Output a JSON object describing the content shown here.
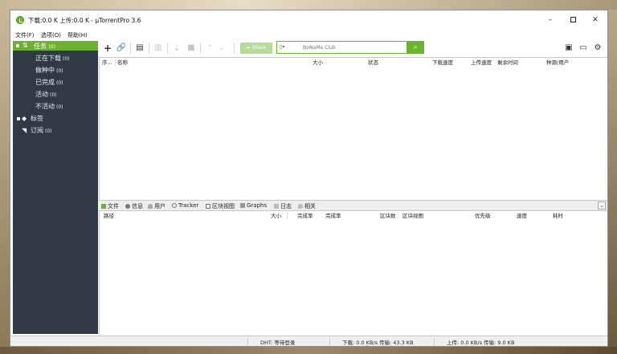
{
  "window": {
    "title": "下载:0.0 K 上传:0.0 K - µTorrentPro 3.6",
    "controls": {
      "minimize": "–",
      "close": "✕"
    }
  },
  "menu": [
    "文件(F)",
    "选项(O)",
    "帮助(H)"
  ],
  "sidebar": {
    "tasks": {
      "label": "任务",
      "count": "(0)"
    },
    "items": [
      {
        "label": "正在下载",
        "count": "(0)"
      },
      {
        "label": "做种中",
        "count": "(0)"
      },
      {
        "label": "已完成",
        "count": "(0)"
      },
      {
        "label": "活动",
        "count": "(0)"
      },
      {
        "label": "不活动",
        "count": "(0)"
      }
    ],
    "labels": {
      "label": "标签"
    },
    "feeds": {
      "label": "订阅",
      "count": "(0)"
    }
  },
  "toolbar": {
    "add": "+",
    "link": "🔗",
    "share_label": "Share",
    "search_provider": "NoNaMe Club",
    "search_placeholder": "",
    "search_go": "⌕"
  },
  "torrent_columns": [
    "序...",
    "名称",
    "大小",
    "状态",
    "下载速度",
    "上传速度",
    "剩余时间",
    "种源/用户"
  ],
  "detail_tabs": [
    "文件",
    "信息",
    "用户",
    "Tracker",
    "区块视图",
    "Graphs",
    "日志",
    "相关"
  ],
  "file_columns": [
    "路径",
    "大小",
    "完成率",
    "完成率",
    "区块数",
    "区块视图",
    "优先级",
    "速度",
    "耗时"
  ],
  "status": {
    "dht": "DHT: 等待登录",
    "download": "下载: 0.0 KB/s 传输: 43.3 KB",
    "upload": "上传: 0.0 KB/s 传输: 9.0 KB"
  },
  "colors": {
    "accent": "#6cb232",
    "sidebar_bg": "#303a44"
  }
}
